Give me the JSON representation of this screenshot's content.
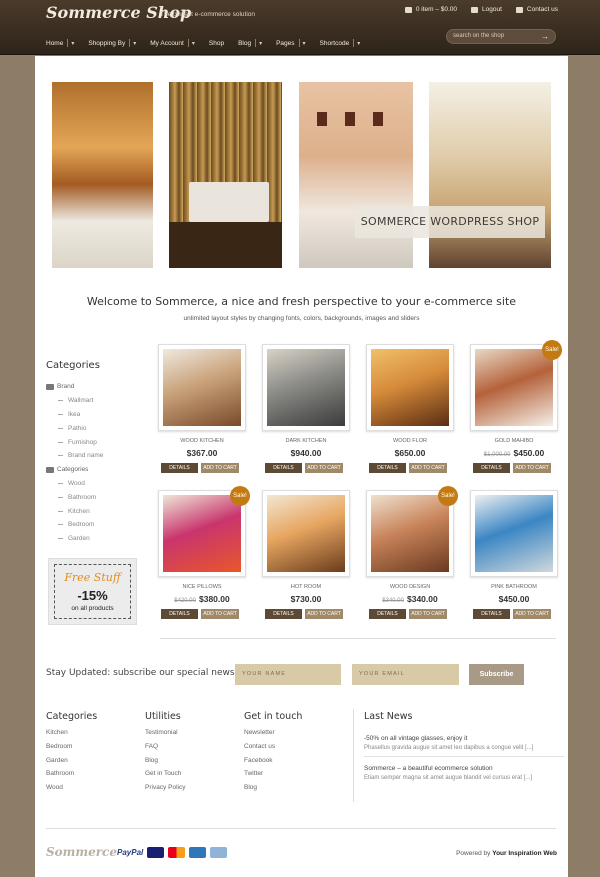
{
  "header": {
    "logo": "Sommerce Shop",
    "tagline": "The perfect e-commerce solution",
    "util": {
      "cart": "0 item – $0.00",
      "logout": "Logout",
      "contact": "Contact us"
    },
    "nav": [
      {
        "label": "Home",
        "dropdown": true
      },
      {
        "label": "Shopping By",
        "dropdown": true
      },
      {
        "label": "My Account",
        "dropdown": true
      },
      {
        "label": "Shop",
        "dropdown": false
      },
      {
        "label": "Blog",
        "dropdown": true
      },
      {
        "label": "Pages",
        "dropdown": true
      },
      {
        "label": "Shortcode",
        "dropdown": true
      }
    ],
    "search": {
      "placeholder": "search on the shop",
      "icon": "arrow-right-icon"
    }
  },
  "hero": {
    "caption": "SOMMERCE WORDPRESS SHOP"
  },
  "welcome": {
    "title": "Welcome to Sommerce, a nice and fresh perspective to your e-commerce site",
    "subtitle": "unlimited layout styles by changing fonts, colors, backgrounds, images and sliders"
  },
  "sidebar": {
    "title": "Categories",
    "groups": [
      {
        "label": "Brand",
        "items": [
          "Wallmart",
          "Ikea",
          "Pathio",
          "Furnishop",
          "Brand name"
        ]
      },
      {
        "label": "Categories",
        "items": [
          "Wood",
          "Bathroom",
          "Kitchen",
          "Bedroom",
          "Garden"
        ]
      }
    ],
    "promo": {
      "line1": "Free Stuff",
      "line2": "-15%",
      "line3": "on all products"
    }
  },
  "products": [
    {
      "name": "WOOD KITCHEN",
      "price": "$367.00",
      "old": "",
      "sale": false,
      "tone": [
        "#7a4a2a",
        "#c9a27a",
        "#efe9e0"
      ]
    },
    {
      "name": "DARK KITCHEN",
      "price": "$940.00",
      "old": "",
      "sale": false,
      "tone": [
        "#3b3b3b",
        "#8a8a86",
        "#d8d2c6"
      ]
    },
    {
      "name": "WOOD FLOR",
      "price": "$650.00",
      "old": "",
      "sale": false,
      "tone": [
        "#5a2d12",
        "#d58a3a",
        "#f1c06a"
      ]
    },
    {
      "name": "GOLD MAHIBO",
      "price": "$450.00",
      "old": "$1,000.00",
      "sale": true,
      "tone": [
        "#f5f0e8",
        "#b4623a",
        "#e8d9c6"
      ]
    },
    {
      "name": "NICE PILLOWS",
      "price": "$380.00",
      "old": "$420.00",
      "sale": true,
      "tone": [
        "#e8572a",
        "#c9356d",
        "#efe7d8"
      ]
    },
    {
      "name": "HOT ROOM",
      "price": "$730.00",
      "old": "",
      "sale": false,
      "tone": [
        "#6a3c1c",
        "#e6a560",
        "#f3e7d2"
      ]
    },
    {
      "name": "WOOD DESIGN",
      "price": "$340.00",
      "old": "$340.00",
      "sale": true,
      "tone": [
        "#6a3a20",
        "#c8835a",
        "#efe1cf"
      ]
    },
    {
      "name": "PINK BATHROOM",
      "price": "$450.00",
      "old": "",
      "sale": false,
      "tone": [
        "#cfd8dc",
        "#3b86c4",
        "#eef0f0"
      ]
    }
  ],
  "product_buttons": {
    "details": "DETAILS",
    "cart": "ADD TO CART",
    "sale": "Sale!"
  },
  "newsletter": {
    "title": "Stay Updated: subscribe our special newsletter",
    "name_placeholder": "YOUR NAME",
    "email_placeholder": "YOUR EMAIL",
    "button": "Subscribe"
  },
  "footer": {
    "categories": {
      "title": "Categories",
      "items": [
        "Kitchen",
        "Bedroom",
        "Garden",
        "Bathroom",
        "Wood"
      ]
    },
    "utilities": {
      "title": "Utilities",
      "items": [
        "Testimonial",
        "FAQ",
        "Blog",
        "Get in Touch",
        "Privacy Policy"
      ]
    },
    "touch": {
      "title": "Get in touch",
      "items": [
        "Newsletter",
        "Contact us",
        "Facebook",
        "Twitter",
        "Blog"
      ]
    },
    "news": {
      "title": "Last News",
      "items": [
        {
          "title": "-50% on all vintage glasses, enjoy it",
          "text": "Phasellus gravida augue sit amet leo dapibus a congue velit [...]"
        },
        {
          "title": "Sommerce – a beautiful ecommerce solution",
          "text": "Etiam semper magna sit amet augue blandit vel cursus erat [...]"
        }
      ]
    },
    "logo": "Sommerce",
    "payments": [
      "PayPal",
      "visa-icon",
      "mastercard-icon",
      "amex-icon",
      "discover-icon"
    ],
    "powered_prefix": "Powered by ",
    "powered_name": "Your Inspiration Web"
  }
}
